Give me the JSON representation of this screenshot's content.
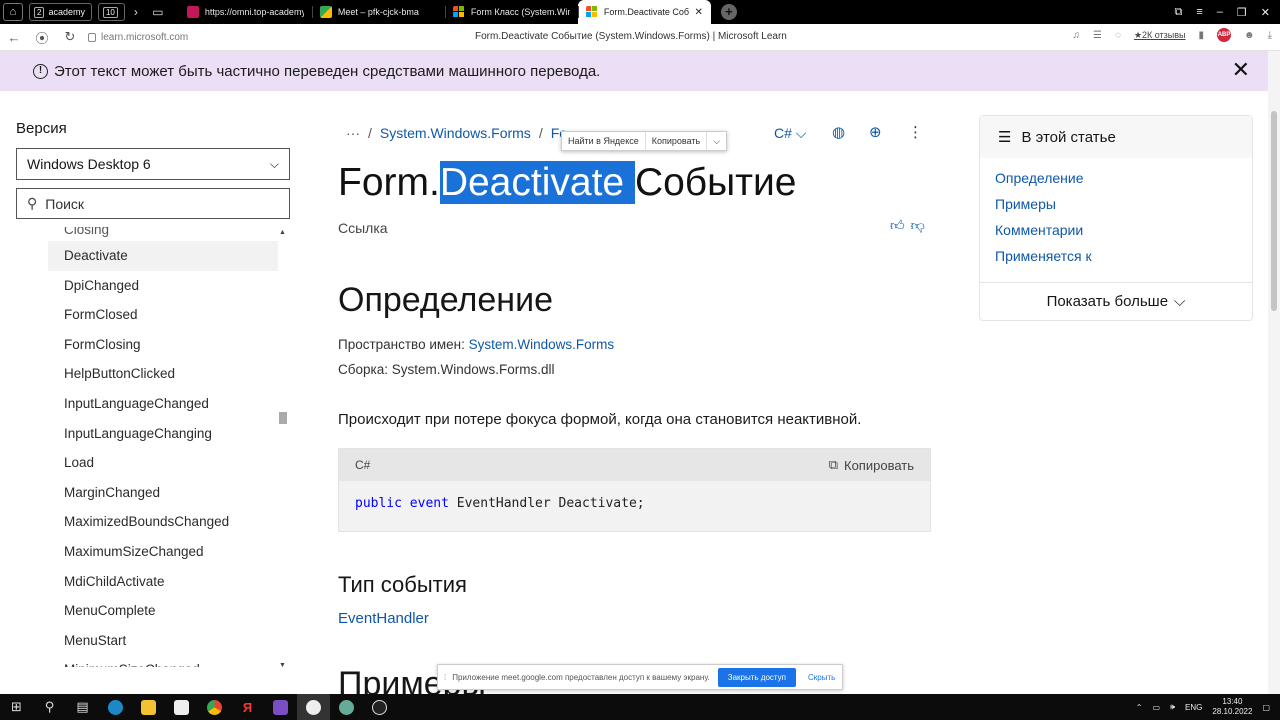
{
  "browser": {
    "group_count": "2",
    "group_label": "academy",
    "tabs_count": "10",
    "tabs": [
      {
        "title": "https://omni.top-academy",
        "icon": "omni-icon"
      },
      {
        "title": "Meet – pfk-cjck-bma",
        "icon": "meet-icon"
      },
      {
        "title": "Form Класс (System.Windo",
        "icon": "microsoft-icon"
      },
      {
        "title": "Form.Deactivate Событ",
        "icon": "microsoft-icon",
        "active": true
      }
    ],
    "url": "learn.microsoft.com",
    "page_title": "Form.Deactivate Событие (System.Windows.Forms) | Microsoft Learn",
    "rating": "★2К отзывы",
    "abp": "ABP"
  },
  "banner": {
    "text": "Этот текст может быть частично переведен средствами машинного перевода."
  },
  "left": {
    "version_label": "Версия",
    "version_value": "Windows Desktop 6",
    "search_placeholder": "Поиск",
    "items": [
      "Closing",
      "Deactivate",
      "DpiChanged",
      "FormClosed",
      "FormClosing",
      "HelpButtonClicked",
      "InputLanguageChanged",
      "InputLanguageChanging",
      "Load",
      "MarginChanged",
      "MaximizedBoundsChanged",
      "MaximumSizeChanged",
      "MdiChildActivate",
      "MenuComplete",
      "MenuStart",
      "MinimumSizeChanged"
    ]
  },
  "main": {
    "breadcrumb_more": "···",
    "breadcrumb_sep": "/",
    "breadcrumb_1": "System.Windows.Forms",
    "breadcrumb_2": "Fo",
    "language": "C#",
    "popup_find": "Найти в Яндексе",
    "popup_copy": "Копировать",
    "title_prefix": "Form.",
    "title_selected": "Deactivate ",
    "title_suffix": "Событие",
    "reference": "Ссылка",
    "definition_heading": "Определение",
    "namespace_label": "Пространство имен:",
    "namespace_value": "System.Windows.Forms",
    "assembly_label": "Сборка:",
    "assembly_value": "System.Windows.Forms.dll",
    "description": "Происходит при потере фокуса формой, когда она становится неактивной.",
    "code_lang": "C#",
    "code_copy": "Копировать",
    "code_kw1": "public",
    "code_kw2": "event",
    "code_rest": "EventHandler Deactivate;",
    "event_type_heading": "Тип события",
    "event_type_link": "EventHandler",
    "examples_heading": "Примеры"
  },
  "toc": {
    "heading": "В этой статье",
    "links": [
      "Определение",
      "Примеры",
      "Комментарии",
      "Применяется к"
    ],
    "more": "Показать больше"
  },
  "share": {
    "text": "Приложение meet.google.com предоставлен доступ к вашему экрану.",
    "stop": "Закрыть доступ",
    "hide": "Скрыть"
  },
  "taskbar": {
    "lang": "ENG",
    "time": "13:40",
    "date": "28.10.2022"
  }
}
